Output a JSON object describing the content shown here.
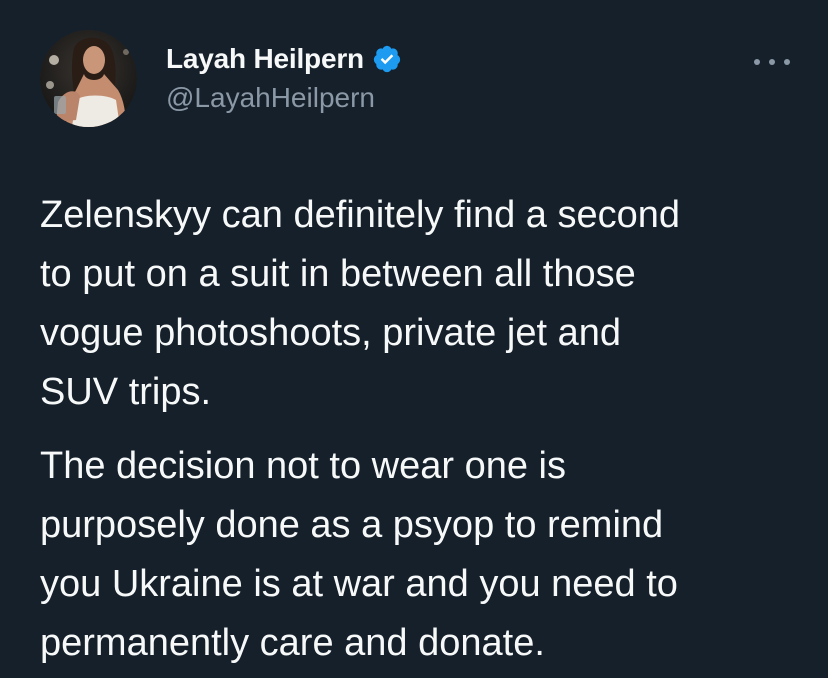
{
  "tweet": {
    "author": {
      "display_name": "Layah Heilpern",
      "handle": "@LayahHeilpern",
      "verified": true,
      "avatar_icon": "profile-photo"
    },
    "more_icon": "more-options-icon",
    "paragraphs": [
      "Zelenskyy can definitely find a second\nto put on a suit in between all those\nvogue photoshoots, private jet and\nSUV trips.",
      "The decision not to wear one is\npurposely done as a psyop to remind\nyou Ukraine is at war and you need to\npermanently care and donate."
    ]
  },
  "colors": {
    "background": "#15202b",
    "text": "#f7f9f9",
    "secondary_text": "#8b98a5",
    "verified_badge": "#1d9bf0"
  }
}
